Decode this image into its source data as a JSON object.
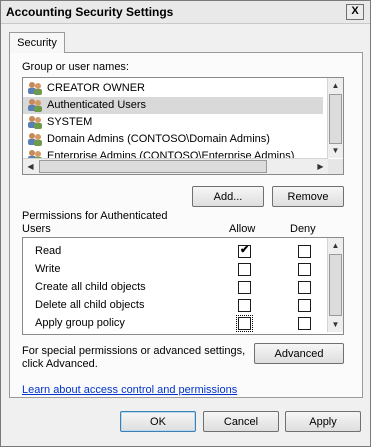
{
  "window": {
    "title": "Accounting Security Settings",
    "close_label": "X"
  },
  "tabs": [
    {
      "label": "Security"
    }
  ],
  "groups": {
    "label": "Group or user names:",
    "items": [
      {
        "name": "CREATOR OWNER"
      },
      {
        "name": "Authenticated Users"
      },
      {
        "name": "SYSTEM"
      },
      {
        "name": "Domain Admins (CONTOSO\\Domain Admins)"
      },
      {
        "name": "Enterprise Admins (CONTOSO\\Enterprise Admins)"
      }
    ],
    "selected_index": 1
  },
  "buttons": {
    "add": "Add...",
    "remove": "Remove",
    "advanced": "Advanced",
    "ok": "OK",
    "cancel": "Cancel",
    "apply": "Apply"
  },
  "permissions": {
    "label_line1": "Permissions for Authenticated",
    "label_line2": "Users",
    "allow_header": "Allow",
    "deny_header": "Deny",
    "rows": [
      {
        "name": "Read",
        "allow": true,
        "deny": false
      },
      {
        "name": "Write",
        "allow": false,
        "deny": false
      },
      {
        "name": "Create all child objects",
        "allow": false,
        "deny": false
      },
      {
        "name": "Delete all child objects",
        "allow": false,
        "deny": false
      },
      {
        "name": "Apply group policy",
        "allow": false,
        "deny": false
      }
    ]
  },
  "special": {
    "line1": "For special permissions or advanced settings,",
    "line2": "click Advanced."
  },
  "help_link": "Learn about access control and permissions",
  "icons": {
    "user_group": "users-icon",
    "check": "✔",
    "arrow_up": "▲",
    "arrow_down": "▼",
    "arrow_left": "◀",
    "arrow_right": "▶"
  }
}
